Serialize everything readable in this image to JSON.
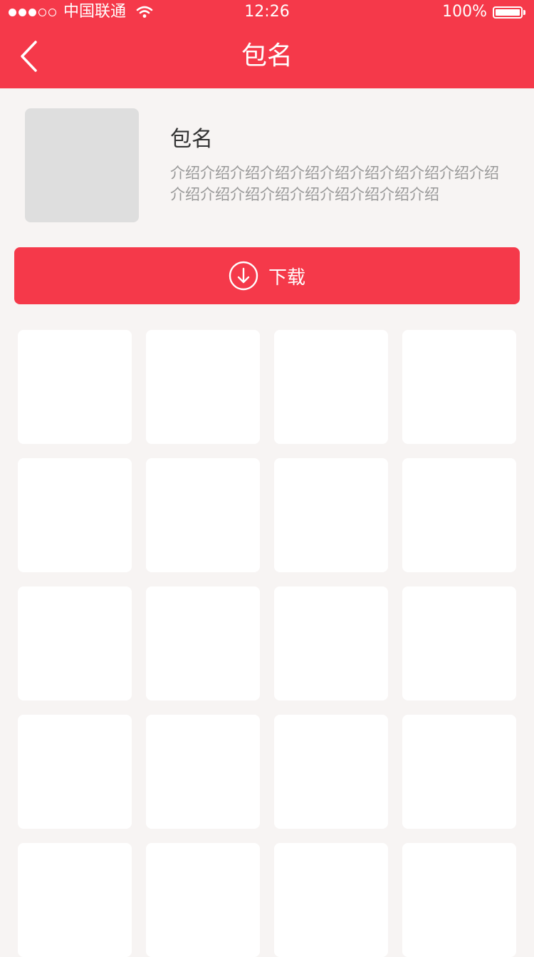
{
  "status_bar": {
    "carrier": "中国联通",
    "time": "12:26",
    "battery": "100%",
    "battery_level": 1.0,
    "signal_strength": 3,
    "signal_max": 5
  },
  "nav": {
    "title": "包名",
    "back_icon": "chevron-left-icon"
  },
  "package": {
    "name": "包名",
    "description": "介绍介绍介绍介绍介绍介绍介绍介绍介绍介绍介绍介绍介绍介绍介绍介绍介绍介绍介绍介绍"
  },
  "download_button": {
    "label": "下载",
    "icon": "download-circle-icon"
  },
  "grid": {
    "columns": 4,
    "visible_rows": 5,
    "item_count": 20
  },
  "colors": {
    "accent": "#f5394a",
    "background": "#f7f4f3",
    "placeholder": "#dedede",
    "card": "#ffffff"
  }
}
